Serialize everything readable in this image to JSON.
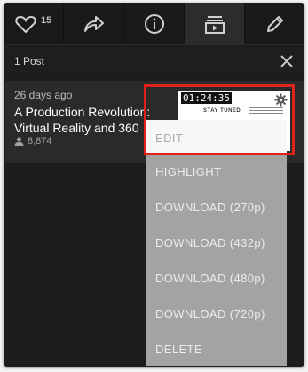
{
  "toolbar": {
    "like_count": "15",
    "buttons": [
      "heart-icon",
      "share-arrow-icon",
      "info-icon",
      "playlist-icon",
      "pencil-icon"
    ]
  },
  "header": {
    "post_count": "1 Post"
  },
  "post": {
    "age": "26 days ago",
    "title": "A Production Revolution:\nVirtual Reality and 360",
    "views": "8,874",
    "thumbnail": {
      "timestamp": "01:24:35",
      "caption": "STAY TUNED"
    }
  },
  "menu": {
    "items": [
      "EDIT",
      "HIGHLIGHT",
      "DOWNLOAD (270p)",
      "DOWNLOAD (432p)",
      "DOWNLOAD (480p)",
      "DOWNLOAD (720p)",
      "DELETE"
    ]
  },
  "colors": {
    "highlight": "#e0221b",
    "menu_bg": "#a3a3a3",
    "toolbar_bg": "#1a1a1a"
  }
}
